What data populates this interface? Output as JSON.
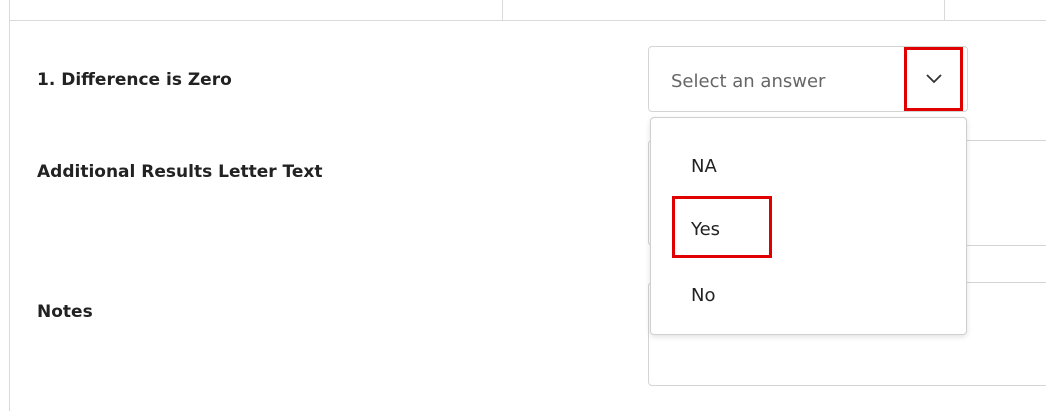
{
  "form": {
    "question_label": "1. Difference is Zero",
    "additional_text_label": "Additional Results Letter Text",
    "notes_label": "Notes"
  },
  "select": {
    "placeholder": "Select an answer",
    "icon": "chevron-down-icon",
    "options": [
      "NA",
      "Yes",
      "No"
    ],
    "highlighted_option": "Yes"
  },
  "colors": {
    "highlight_border": "#e00000",
    "field_border": "#d4d4d4"
  }
}
